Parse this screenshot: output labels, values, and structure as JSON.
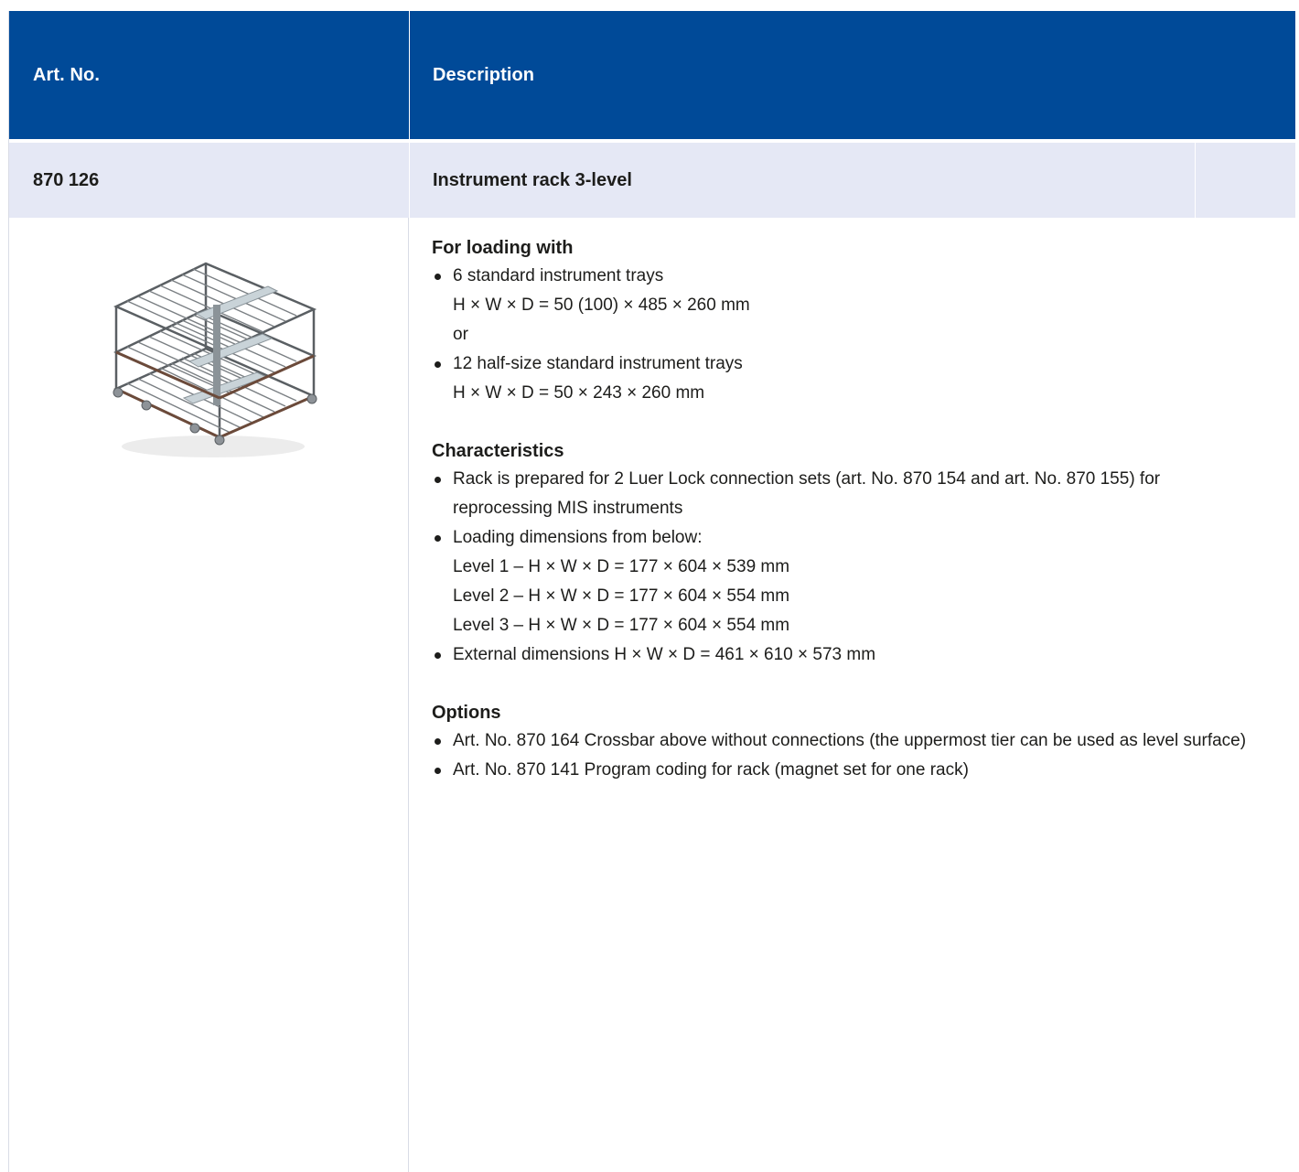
{
  "table": {
    "header": {
      "art_no_label": "Art. No.",
      "description_label": "Description"
    },
    "product": {
      "art_no": "870 126",
      "name": "Instrument rack 3-level"
    },
    "image": {
      "icon": "instrument-rack-3-level-image",
      "frame_color": "#5a5f63",
      "rail_color": "#6b4a3a",
      "tray_color": "#c9d3d8"
    },
    "loading": {
      "title": "For loading with",
      "item1": {
        "text": "6 standard instrument trays",
        "dims": "H × W × D = 50 (100) × 485 × 260 mm"
      },
      "or": "or",
      "item2": {
        "text": "12 half-size standard instrument trays",
        "dims": "H × W × D = 50 × 243 × 260 mm"
      }
    },
    "characteristics": {
      "title": "Characteristics",
      "item1": {
        "line1": "Rack is prepared for 2 Luer Lock connection sets (art. No. 870 154 and art. No. 870 155) for",
        "line2": "reprocessing MIS instruments"
      },
      "item2": {
        "text": "Loading dimensions from below:",
        "level1": "Level 1 – H × W × D = 177 × 604 × 539 mm",
        "level2": "Level 2 – H × W × D = 177 × 604 × 554 mm",
        "level3": "Level 3 – H × W × D = 177 × 604 × 554 mm"
      },
      "item3": "External dimensions H × W × D = 461 × 610 × 573 mm"
    },
    "options": {
      "title": "Options",
      "item1": "Art. No. 870 164 Crossbar above without connections (the uppermost tier can be used as level surface)",
      "item2": "Art. No. 870 141 Program coding for rack (magnet set for one rack)"
    }
  },
  "colors": {
    "header_bg": "#004a98",
    "product_row_bg": "#e5e8f5",
    "divider": "#d9dce6"
  }
}
